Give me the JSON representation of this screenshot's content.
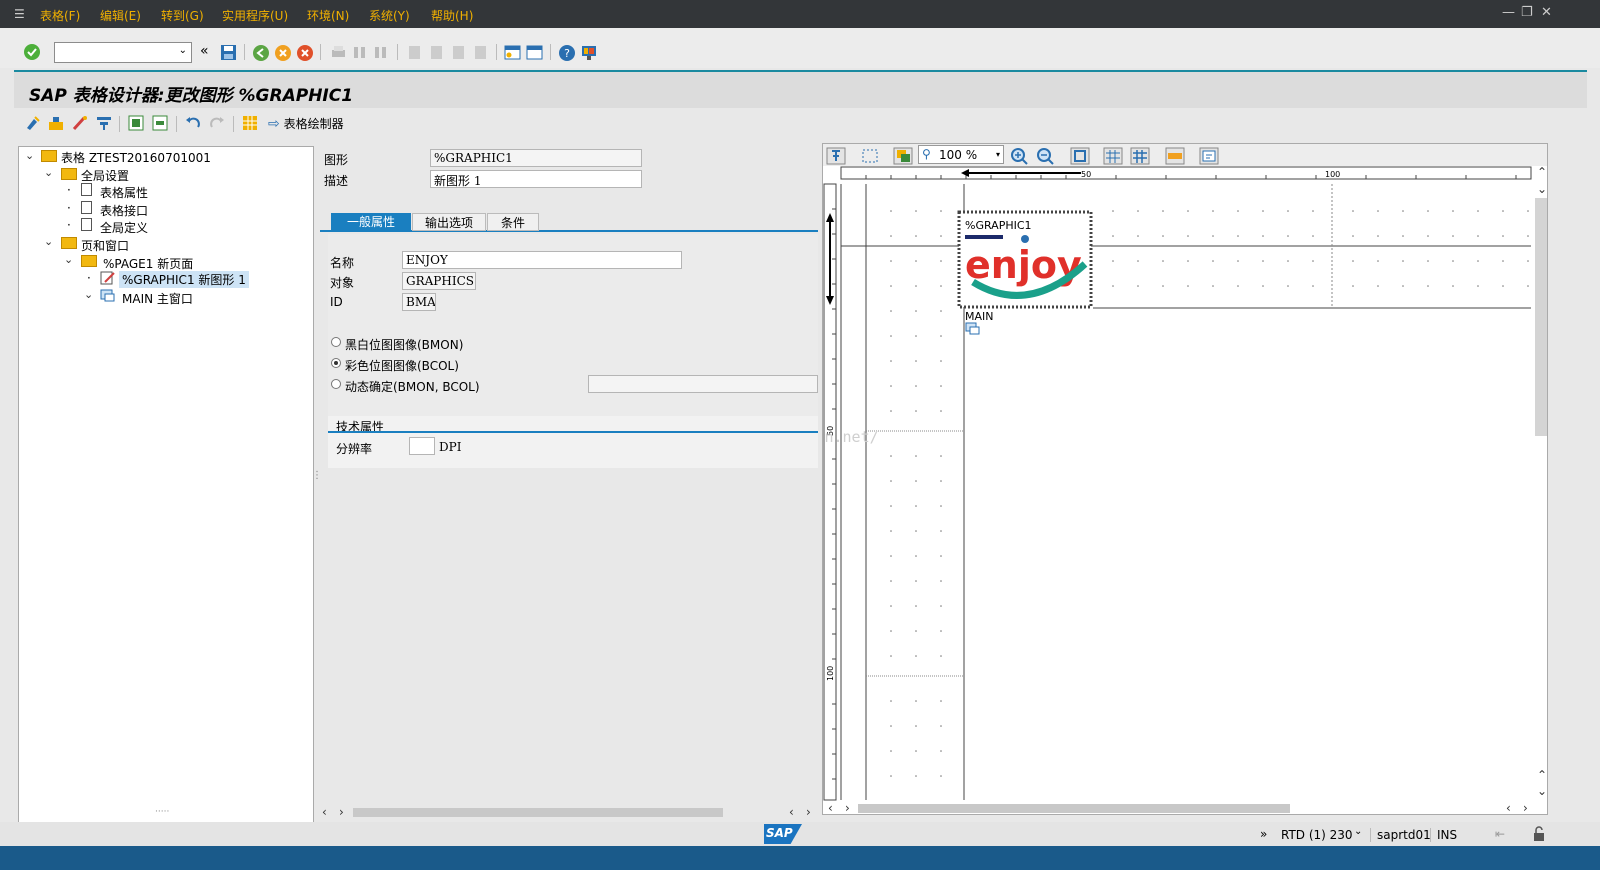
{
  "menu": {
    "items": [
      "表格(F)",
      "编辑(E)",
      "转到(G)",
      "实用程序(U)",
      "环境(N)",
      "系统(Y)",
      "帮助(H)"
    ]
  },
  "window_controls": {
    "minimize": "—",
    "restore": "❐",
    "close": "✕"
  },
  "toolbar": {
    "command_field": {
      "value": "",
      "placeholder": ""
    },
    "back_label": "«"
  },
  "title": "SAP 表格设计器:更改图形 %GRAPHIC1",
  "app_toolbar": {
    "form_painter_label": "表格绘制器"
  },
  "tree": {
    "root": "表格 ZTEST20160701001",
    "global_settings": "全局设置",
    "form_attributes": "表格属性",
    "form_interface": "表格接口",
    "global_definitions": "全局定义",
    "pages_windows": "页和窗口",
    "page1": "%PAGE1 新页面",
    "graphic1": "%GRAPHIC1 新图形 1",
    "main": "MAIN 主窗口"
  },
  "detail": {
    "graphic_label": "图形",
    "graphic_value": "%GRAPHIC1",
    "desc_label": "描述",
    "desc_value": "新图形 1",
    "tabs": [
      "一般属性",
      "输出选项",
      "条件"
    ],
    "name_label": "名称",
    "name_value": "ENJOY",
    "object_label": "对象",
    "object_value": "GRAPHICS",
    "id_label": "ID",
    "id_value": "BMAP",
    "radios": [
      "黑白位图图像(BMON)",
      "彩色位图图像(BCOL)",
      "动态确定(BMON, BCOL)"
    ],
    "radio_selected": 1,
    "tech_header": "技术属性",
    "resolution_label": "分辨率",
    "resolution_value": "",
    "resolution_unit": "DPI"
  },
  "painter": {
    "zoom": "100 %",
    "ruler_top": [
      "50",
      "100"
    ],
    "ruler_left": [
      "50",
      "100"
    ],
    "graphic_name": "%GRAPHIC1",
    "logo_text": "enjoy",
    "main_label": "MAIN",
    "watermark": "http://blog.csdn.net/"
  },
  "status": {
    "system": "RTD (1) 230",
    "server": "saprtd01",
    "mode": "INS",
    "logo": "SAP"
  },
  "colors": {
    "menu_bg": "#333639",
    "menu_text": "#f0b000",
    "accent": "#1a8aa0",
    "tab_active": "#1a7fc0"
  }
}
